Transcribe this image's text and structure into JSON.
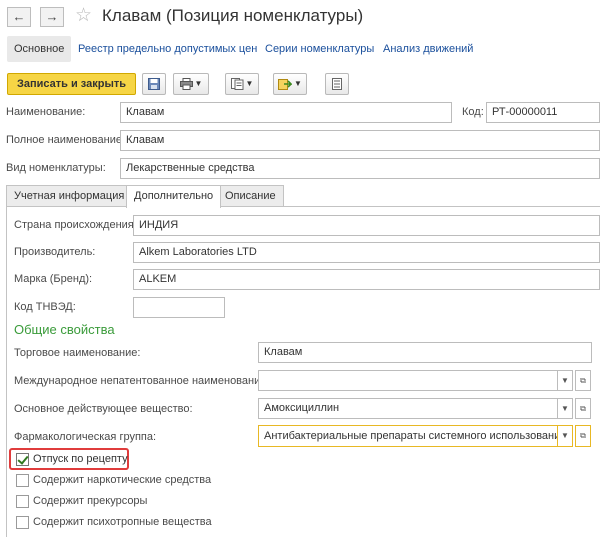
{
  "window": {
    "title": "Клавам (Позиция номенклатуры)",
    "back_icon": "arrow-left-icon",
    "forward_icon": "arrow-right-icon",
    "star_icon": "star-icon"
  },
  "nav": {
    "tabs": [
      {
        "label": "Основное",
        "active": true
      },
      {
        "label": "Реестр предельно допустимых цен"
      },
      {
        "label": "Серии номенклатуры"
      },
      {
        "label": "Анализ движений"
      }
    ]
  },
  "toolbar": {
    "save_close_label": "Записать и закрыть",
    "icons": [
      "save-icon",
      "print-icon",
      "report-icon",
      "create-based-on-icon",
      "list-icon"
    ]
  },
  "header_fields": {
    "name_label": "Наименование:",
    "name_value": "Клавам",
    "code_label": "Код:",
    "code_value": "РТ-00000011",
    "full_name_label": "Полное наименование:",
    "full_name_value": "Клавам",
    "kind_label": "Вид номенклатуры:",
    "kind_value": "Лекарственные средства"
  },
  "tabs": [
    {
      "label": "Учетная информация"
    },
    {
      "label": "Дополнительно",
      "active": true
    },
    {
      "label": "Описание"
    }
  ],
  "additional": {
    "country_label": "Страна происхождения:",
    "country_value": "ИНДИЯ",
    "manufacturer_label": "Производитель:",
    "manufacturer_value": "Alkem Laboratories LTD",
    "brand_label": "Марка (Бренд):",
    "brand_value": "ALKEM",
    "tnved_label": "Код ТНВЭД:",
    "tnved_value": ""
  },
  "general": {
    "section_title": "Общие свойства",
    "trade_name_label": "Торговое наименование:",
    "trade_name_value": "Клавам",
    "inn_label": "Международное непатентованное наименование:",
    "inn_value": "",
    "active_substance_label": "Основное действующее вещество:",
    "active_substance_value": "Амоксициллин",
    "pharm_group_label": "Фармакологическая группа:",
    "pharm_group_value": "Антибактериальные препараты системного использования"
  },
  "checkboxes": [
    {
      "label": "Отпуск по рецепту",
      "checked": true
    },
    {
      "label": "Содержит наркотические средства",
      "checked": false
    },
    {
      "label": "Содержит прекурсоры",
      "checked": false
    },
    {
      "label": "Содержит психотропные вещества",
      "checked": false
    }
  ],
  "colors": {
    "primary_button": "#f6d545",
    "link": "#1a4f9c",
    "section_title": "#3a9b3a",
    "focus_border": "#e8b824",
    "highlight": "#e03c3c"
  }
}
